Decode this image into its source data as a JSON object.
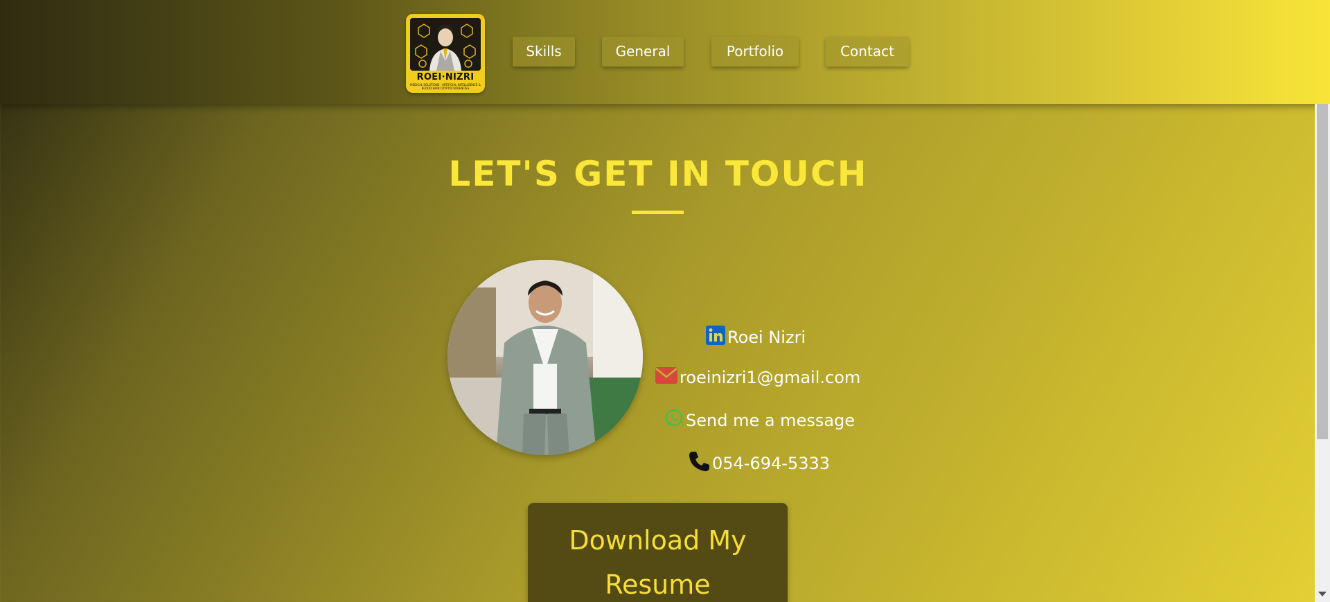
{
  "header": {
    "logo": {
      "title": "ROEI·NIZRI",
      "subtitle": "MEDICAL SOLUTIONS · ARTIFICIAL INTELLIGENCE & BLOCKCHAIN CRYPTOCURRENCIES"
    },
    "nav": [
      {
        "label": "Skills"
      },
      {
        "label": "General"
      },
      {
        "label": "Portfolio"
      },
      {
        "label": "Contact"
      }
    ]
  },
  "main": {
    "heading": "LET'S GET IN TOUCH",
    "contacts": [
      {
        "icon": "linkedin-icon",
        "label": "Roei Nizri"
      },
      {
        "icon": "envelope-icon",
        "label": "roeinizri1@gmail.com"
      },
      {
        "icon": "whatsapp-icon",
        "label": "Send me a message"
      },
      {
        "icon": "phone-icon",
        "label": "054-694-5333"
      }
    ],
    "resume_button": "Download My Resume"
  },
  "colors": {
    "accent_yellow": "#fbe739",
    "linkedin_blue": "#0a66c2",
    "mail_red": "#d9463b",
    "whatsapp_green": "#3ec14e",
    "button_bg": "#544b14"
  }
}
